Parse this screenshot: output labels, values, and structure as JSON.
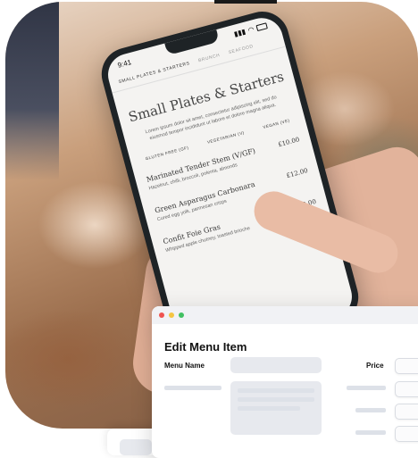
{
  "phone": {
    "status": {
      "time": "9:41"
    },
    "tabs": [
      {
        "label": "SMALL PLATES & STARTERS",
        "active": true
      },
      {
        "label": "BRUNCH",
        "active": false
      },
      {
        "label": "SEAFOOD",
        "active": false
      }
    ],
    "menu_title": "Small Plates & Starters",
    "menu_description": "Lorem ipsum dolor sit amet, consectetur adipiscing elit, sed do eiusmod tempor incididunt ut labore et dolore magna aliqua.",
    "filters": [
      "GLUTEN FREE (GF)",
      "VEGETARIAN (V)",
      "VEGAN (VE)"
    ],
    "dishes": [
      {
        "name": "Marinated Tender Stem (V/GF)",
        "price": "£10.00",
        "description": "Hazelnut, chilli, broccoli, polenta, almonds"
      },
      {
        "name": "Green Asparagus Carbonara",
        "price": "£12.00",
        "description": "Cured egg yolk, parmesan crisps"
      },
      {
        "name": "Confit Foie Gras",
        "price": "£20.00",
        "description": "Whipped apple chutney, toasted brioche"
      }
    ]
  },
  "edit_window": {
    "title": "Edit Menu Item",
    "menu_name_label": "Menu Name",
    "price_label": "Price",
    "traffic_lights": {
      "close": "#ef5350",
      "minimize": "#f5c542",
      "zoom": "#42c062"
    }
  }
}
